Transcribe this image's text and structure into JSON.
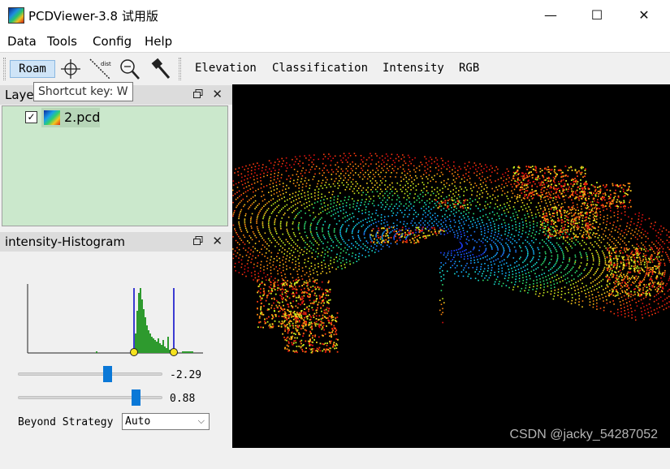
{
  "window": {
    "title": "PCDViewer-3.8 试用版",
    "minimize_glyph": "—",
    "maximize_glyph": "☐",
    "close_glyph": "✕"
  },
  "menu": [
    "Data",
    "Tools",
    "Config",
    "Help"
  ],
  "toolbar": {
    "roam_label": "Roam",
    "tool_icons": [
      "crosshair-icon",
      "measure-distance-icon",
      "zoom-icon",
      "hammer-icon"
    ],
    "measure_icon_text": "dist",
    "color_modes": [
      "Elevation",
      "Classification",
      "Intensity",
      "RGB"
    ]
  },
  "tooltip": "Shortcut key: W",
  "layers_dock": {
    "title": "Layers",
    "items": [
      {
        "name": "2.pcd",
        "checked": true,
        "check_glyph": "✓"
      }
    ],
    "close_glyph": "✕"
  },
  "histogram_dock": {
    "title": "intensity-Histogram",
    "close_glyph": "✕",
    "slider_low_value": "-2.29",
    "slider_high_value": "0.88",
    "slider_low_fraction": 0.63,
    "slider_high_fraction": 0.84,
    "beyond_strategy_label": "Beyond Strategy",
    "beyond_strategy_value": "Auto",
    "dropdown_glyph": "⌵"
  },
  "viewport": {
    "watermark": "CSDN @jacky_54287052"
  },
  "colors": {
    "layer_panel_bg": "#cbe8cc",
    "accent": "#0a78d7",
    "histogram_bar": "#2e9a2e",
    "histogram_marker": "#0000c8"
  }
}
